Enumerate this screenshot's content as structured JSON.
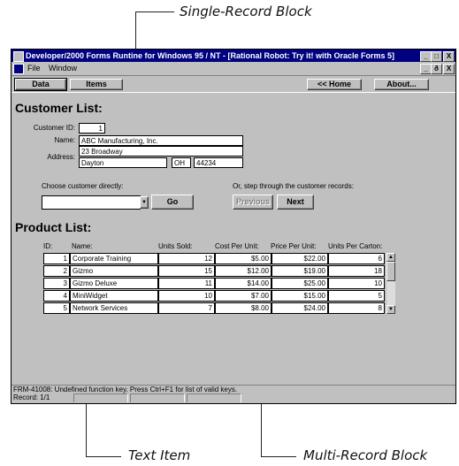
{
  "callouts": {
    "single_record_block": "Single-Record Block",
    "text_item": "Text Item",
    "multi_record_block": "Multi-Record Block"
  },
  "window": {
    "title": "Developer/2000 Forms Runtine for Windows 95 / NT - [Rational Robot:  Try it! with Oracle Forms 5]",
    "menu": [
      "File",
      "Window"
    ],
    "title_buttons": [
      "_",
      "□",
      "X"
    ],
    "menu_buttons": [
      "_",
      "ð",
      "X"
    ]
  },
  "toolbar": {
    "data_label": "Data",
    "items_label": "Items",
    "home_label": "<< Home",
    "about_label": "About..."
  },
  "customer": {
    "section_title": "Customer List:",
    "id_label": "Customer ID:",
    "id_value": "1",
    "name_label": "Name:",
    "name_value": "ABC Manufacturing, Inc.",
    "address_label": "Address:",
    "address1": "23 Broadway",
    "city": "Dayton",
    "state": "OH",
    "zip": "44234",
    "choose_label": "Choose customer directly:",
    "choose_value": "",
    "go_label": "Go",
    "step_label": "Or, step through the customer records:",
    "previous_label": "Previous",
    "next_label": "Next"
  },
  "products": {
    "section_title": "Product List:",
    "columns": [
      "ID:",
      "Name:",
      "Units Sold:",
      "Cost Per Unit:",
      "Price Per Unit:",
      "Units Per Carton:"
    ],
    "rows": [
      [
        "1",
        "Corporate Training",
        "12",
        "$5.00",
        "$22.00",
        "6"
      ],
      [
        "2",
        "Gizmo",
        "15",
        "$12.00",
        "$19.00",
        "18"
      ],
      [
        "3",
        "Gizmo Deluxe",
        "11",
        "$14.00",
        "$25.00",
        "10"
      ],
      [
        "4",
        "MiniWidget",
        "10",
        "$7.00",
        "$15.00",
        "5"
      ],
      [
        "5",
        "Network Services",
        "7",
        "$8.00",
        "$24.00",
        "8"
      ]
    ]
  },
  "status": {
    "message": "FRM-41008: Undefined function key.  Press Ctrl+F1  for list of valid keys.",
    "record": "Record: 1/1"
  }
}
